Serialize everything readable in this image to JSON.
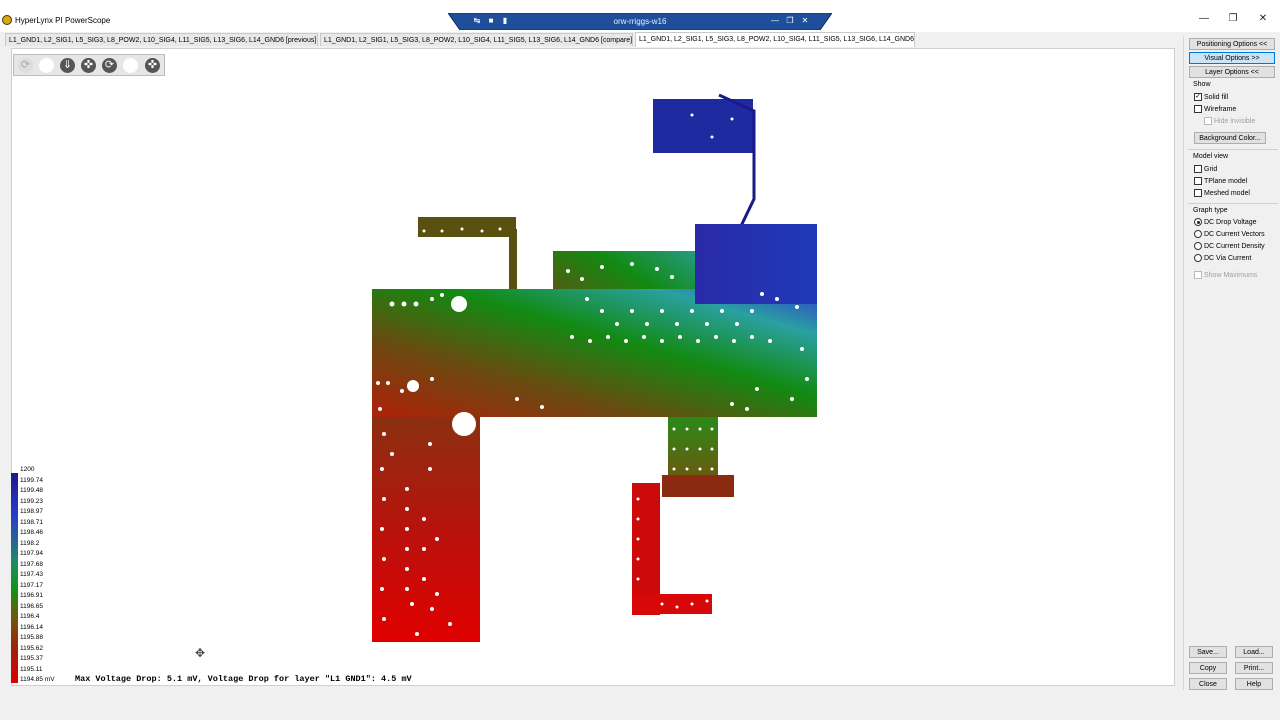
{
  "window": {
    "title": "HyperLynx PI PowerScope",
    "remote_title": "orw-rriggs-w16"
  },
  "tabs": [
    {
      "label": "L1_GND1, L2_SIG1, L5_SIG3, L8_POW2, L10_SIG4, L11_SIG5, L13_SIG6, L14_GND6 [previous]"
    },
    {
      "label": "L1_GND1, L2_SIG1, L5_SIG3, L8_POW2, L10_SIG4, L11_SIG5, L13_SIG6, L14_GND6 [compare]"
    },
    {
      "label": "L1_GND1, L2_SIG1, L5_SIG3, L8_POW2, L10_SIG4, L11_SIG5, L13_SIG6, L14_GND6"
    }
  ],
  "toolbar": {
    "icons": [
      "rotate-icon",
      "blank-icon",
      "zoom-in-icon",
      "target-icon",
      "refresh-icon",
      "blank-icon",
      "fit-icon"
    ]
  },
  "legend": {
    "labels": [
      "1200",
      "1199.74",
      "1199.48",
      "1199.23",
      "1198.97",
      "1198.71",
      "1198.46",
      "1198.2",
      "1197.94",
      "1197.68",
      "1197.43",
      "1197.17",
      "1196.91",
      "1196.65",
      "1196.4",
      "1196.14",
      "1195.88",
      "1195.62",
      "1195.37",
      "1195.11",
      "1194.85 mV"
    ]
  },
  "status": {
    "text": "Max Voltage Drop: 5.1 mV, Voltage Drop for layer \"L1 GND1\": 4.5 mV"
  },
  "panel": {
    "positioning_options": "Positioning Options <<",
    "visual_options": "Visual Options >>",
    "layer_options": "Layer Options <<",
    "show_title": "Show",
    "solid_fill": "Solid fill",
    "wireframe": "Wireframe",
    "hide_invisible": "Hide invisible",
    "background_color": "Background Color...",
    "model_view_title": "Model view",
    "grid": "Grid",
    "tplane_model": "TPlane model",
    "meshed_model": "Meshed model",
    "graph_type_title": "Graph type",
    "dc_drop_voltage": "DC Drop Voltage",
    "dc_current_vectors": "DC Current Vectors",
    "dc_current_density": "DC Current Density",
    "dc_via_current": "DC Via Current",
    "show_maximums": "Show Maximums",
    "save": "Save...",
    "load": "Load...",
    "copy": "Copy",
    "print": "Print...",
    "close": "Close",
    "help": "Help"
  },
  "colors": {
    "high": "#1a1a8c",
    "mid": "#149414",
    "low": "#dd0000",
    "accent": "#0078d7"
  }
}
